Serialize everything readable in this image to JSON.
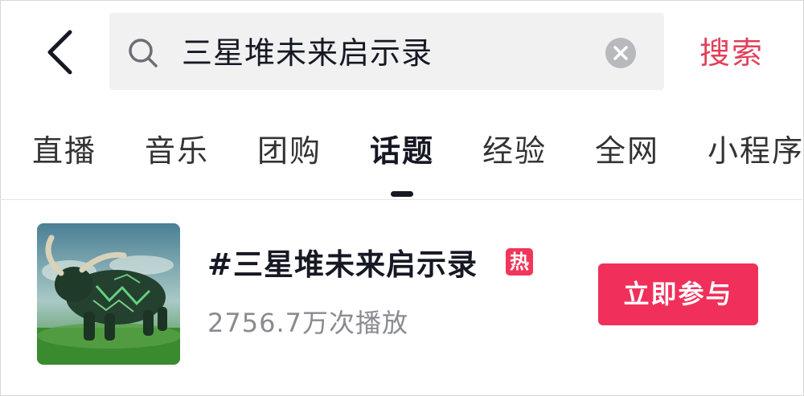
{
  "search": {
    "query": "三星堆未来启示录",
    "submit_label": "搜索"
  },
  "tabs": [
    {
      "label": "直播",
      "active": false
    },
    {
      "label": "音乐",
      "active": false
    },
    {
      "label": "团购",
      "active": false
    },
    {
      "label": "话题",
      "active": true
    },
    {
      "label": "经验",
      "active": false
    },
    {
      "label": "全网",
      "active": false
    },
    {
      "label": "小程序",
      "active": false
    }
  ],
  "topic": {
    "title": "#三星堆未来启示录",
    "hot_badge": "热",
    "play_count": "2756.7万次播放",
    "join_label": "立即参与",
    "thumbnail_icon": "bull-image"
  },
  "colors": {
    "accent": "#f0305a",
    "search_link": "#e0405a",
    "secondary_text": "#8a8b91"
  }
}
